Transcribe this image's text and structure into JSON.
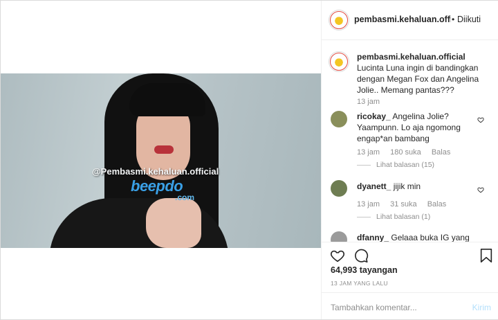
{
  "post": {
    "username": "pembasmi.kehaluan.official",
    "header_separator": "•",
    "follow_label": "Diikuti",
    "caption": "Lucinta Luna ingin di bandingkan dengan Megan Fox dan Angelina Jolie.. Memang pantas???",
    "caption_time": "13 jam"
  },
  "video": {
    "watermark_handle": "@Pembasmi.kehaluan.official",
    "watermark_brand": "beepdo",
    "watermark_domain": ".com"
  },
  "comments": [
    {
      "username": "ricokay_",
      "text": "Angelina Jolie? Yaampunn. Lo aja ngomong engap*an bambang",
      "time": "13 jam",
      "likes": "180 suka",
      "reply_label": "Balas",
      "view_replies": "Lihat balasan (15)"
    },
    {
      "username": "dyanett_",
      "text": "jijik min",
      "time": "13 jam",
      "likes": "31 suka",
      "reply_label": "Balas",
      "view_replies": "Lihat balasan (1)"
    },
    {
      "username": "dfanny_",
      "text": "Gelaaa buka IG yang"
    }
  ],
  "stats": {
    "views": "64,993 tayangan",
    "time_ago": "13 JAM YANG LALU"
  },
  "add_comment": {
    "placeholder": "Tambahkan komentar...",
    "send_label": "Kirim"
  },
  "icons": [
    "heart-icon",
    "comment-icon",
    "bookmark-icon",
    "heart-small-icon",
    "avatar-logo-icon"
  ],
  "colors": {
    "text": "#262626",
    "muted": "#8e8e8e",
    "border": "#efefef",
    "send_disabled": "#b2dffc",
    "watermark_blue": "#3aa0e6"
  }
}
